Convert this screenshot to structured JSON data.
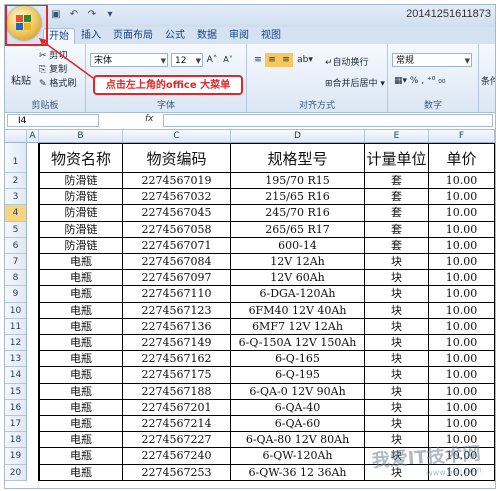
{
  "window": {
    "title": "20141251611873"
  },
  "quick_access": [
    "save-icon",
    "undo-icon",
    "redo-icon",
    "customize-icon"
  ],
  "tabs": [
    "开始",
    "插入",
    "页面布局",
    "公式",
    "数据",
    "审阅",
    "视图"
  ],
  "ribbon": {
    "clipboard": {
      "label": "剪贴板",
      "paste": "粘贴",
      "cut": "剪切",
      "copy": "复制",
      "format_painter": "格式刷"
    },
    "font": {
      "label": "字体",
      "name": "宋体",
      "size": "12",
      "grow": "A",
      "shrink": "A"
    },
    "alignment": {
      "label": "对齐方式",
      "wrap": "自动换行",
      "merge": "合并后居中"
    },
    "number": {
      "label": "数字",
      "format": "常规"
    },
    "styles": {
      "label": "条件"
    }
  },
  "callout": "点击左上角的office 大菜单",
  "formula_bar": {
    "name_box": "I4",
    "fx": "fx",
    "value": ""
  },
  "columns": [
    "A",
    "B",
    "C",
    "D",
    "E",
    "F"
  ],
  "header_row": [
    "物资名称",
    "物资编码",
    "规格型号",
    "计量单位",
    "单价"
  ],
  "rows": [
    [
      "防滑链",
      "2274567019",
      "195/70 R15",
      "套",
      "10.00"
    ],
    [
      "防滑链",
      "2274567032",
      "215/65 R16",
      "套",
      "10.00"
    ],
    [
      "防滑链",
      "2274567045",
      "245/70 R16",
      "套",
      "10.00"
    ],
    [
      "防滑链",
      "2274567058",
      "265/65 R17",
      "套",
      "10.00"
    ],
    [
      "防滑链",
      "2274567071",
      "600-14",
      "套",
      "10.00"
    ],
    [
      "电瓶",
      "2274567084",
      "12V 12Ah",
      "块",
      "10.00"
    ],
    [
      "电瓶",
      "2274567097",
      "12V 60Ah",
      "块",
      "10.00"
    ],
    [
      "电瓶",
      "2274567110",
      "6-DGA-120Ah",
      "块",
      "10.00"
    ],
    [
      "电瓶",
      "2274567123",
      "6FM40 12V 40Ah",
      "块",
      "10.00"
    ],
    [
      "电瓶",
      "2274567136",
      "6MF7 12V 12Ah",
      "块",
      "10.00"
    ],
    [
      "电瓶",
      "2274567149",
      "6-Q-150A 12V 150Ah",
      "块",
      "10.00"
    ],
    [
      "电瓶",
      "2274567162",
      "6-Q-165",
      "块",
      "10.00"
    ],
    [
      "电瓶",
      "2274567175",
      "6-Q-195",
      "块",
      "10.00"
    ],
    [
      "电瓶",
      "2274567188",
      "6-QA-0 12V 90Ah",
      "块",
      "10.00"
    ],
    [
      "电瓶",
      "2274567201",
      "6-QA-40",
      "块",
      "10.00"
    ],
    [
      "电瓶",
      "2274567214",
      "6-QA-60",
      "块",
      "10.00"
    ],
    [
      "电瓶",
      "2274567227",
      "6-QA-80 12V 80Ah",
      "块",
      "10.00"
    ],
    [
      "电瓶",
      "2274567240",
      "6-QW-120Ah",
      "块",
      "10.00"
    ],
    [
      "电瓶",
      "2274567253",
      "6-QW-36 12 36Ah",
      "块",
      "10.00"
    ]
  ],
  "row_numbers": [
    "1",
    "2",
    "3",
    "4",
    "5",
    "6",
    "7",
    "8",
    "9",
    "10",
    "11",
    "12",
    "13",
    "14",
    "15",
    "16",
    "17",
    "18",
    "19",
    "20"
  ],
  "watermark": {
    "text": "我爱IT技术网",
    "url": "www.52ij.com"
  }
}
